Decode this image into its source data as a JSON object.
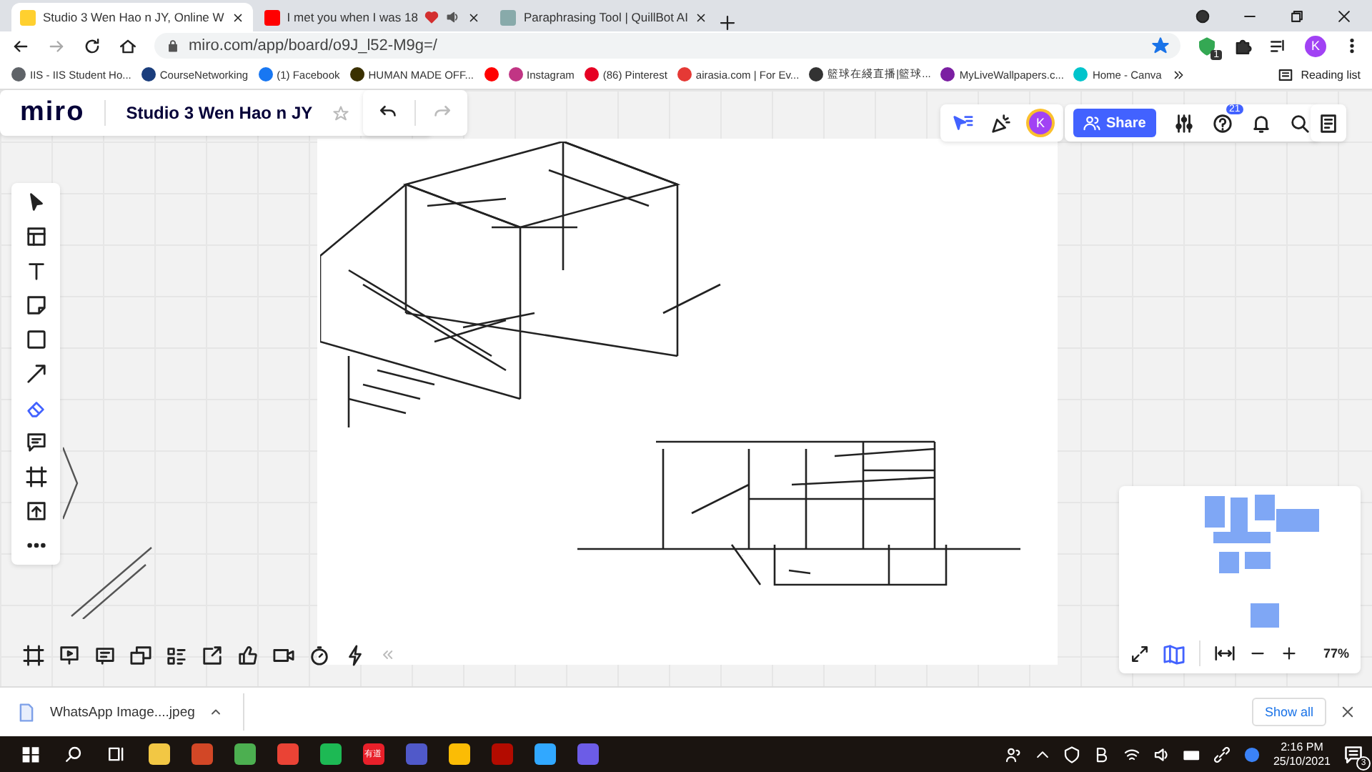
{
  "browser": {
    "tabs": [
      {
        "title": "Studio 3 Wen Hao n JY, Online W",
        "selected": true,
        "audio": false
      },
      {
        "title": "I met you when I was 18",
        "selected": false,
        "audio": true
      },
      {
        "title": "Paraphrasing Tool | QuillBot AI",
        "selected": false,
        "audio": false
      }
    ],
    "url": "miro.com/app/board/o9J_l52-M9g=/",
    "extension_badge": "1",
    "profile_initial": "K",
    "bookmarks": [
      {
        "label": "IIS - IIS Student Ho...",
        "color": "#5f6368"
      },
      {
        "label": "CourseNetworking",
        "color": "#1a3d7c"
      },
      {
        "label": "(1) Facebook",
        "color": "#1877f2"
      },
      {
        "label": "HUMAN MADE OFF...",
        "color": "#3a3000"
      },
      {
        "color": "#ff0000"
      },
      {
        "label": "Instagram",
        "color": "#c13584"
      },
      {
        "label": "(86) Pinterest",
        "color": "#e60023"
      },
      {
        "label": "airasia.com | For Ev...",
        "color": "#e53935"
      },
      {
        "label": "籃球在綫直播|籃球...",
        "color": "#333333"
      },
      {
        "label": "MyLiveWallpapers.c...",
        "color": "#7b1fa2"
      },
      {
        "label": "Home - Canva",
        "color": "#00c4cc"
      }
    ],
    "reading_list": "Reading list"
  },
  "board": {
    "logo": "miro",
    "title": "Studio 3 Wen Hao n JY",
    "starred": false,
    "avatar_initial": "K",
    "share": "Share",
    "help_badge": "21",
    "zoom": "77%"
  },
  "download": {
    "file": "WhatsApp Image....jpeg",
    "show_all": "Show all"
  },
  "taskbar": {
    "apps": [
      {
        "color": "#f2c744"
      },
      {
        "color": "#d24726"
      },
      {
        "color": "#4caf50"
      },
      {
        "color": "#ea4335"
      },
      {
        "color": "#1db954"
      },
      {
        "color": "#e8202a",
        "label": "有道"
      },
      {
        "color": "#5059c9"
      },
      {
        "color": "#fbbc05"
      },
      {
        "color": "#b30b00"
      },
      {
        "color": "#31a8ff"
      },
      {
        "color": "#6c5ce7"
      }
    ],
    "time": "2:16 PM",
    "date": "25/10/2021",
    "notification_count": "3"
  }
}
